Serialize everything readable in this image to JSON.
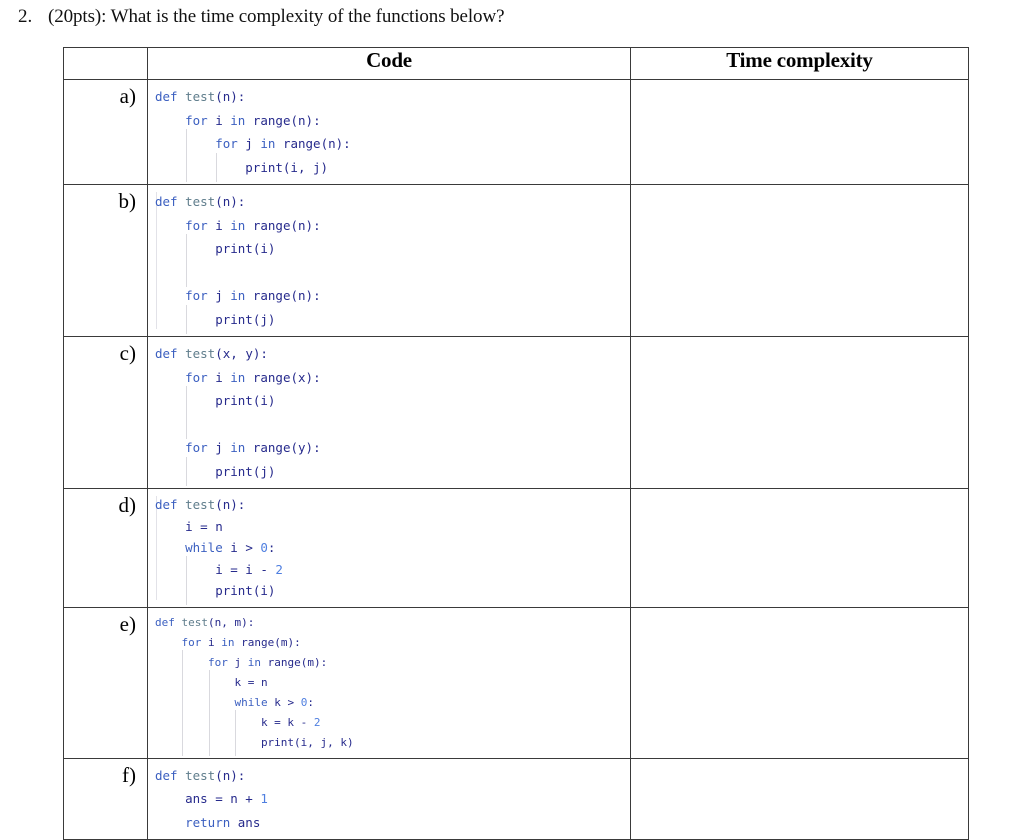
{
  "question": {
    "number": "2.",
    "text": "(20pts): What is the time complexity of the functions below?"
  },
  "table": {
    "headers": {
      "label_col": "",
      "code_col": "Code",
      "answer_col": "Time complexity"
    },
    "rows": [
      {
        "label": "a)",
        "answer": "",
        "code": "def test(n):\n    for i in range(n):\n        for j in range(n):\n            print(i, j)"
      },
      {
        "label": "b)",
        "answer": "",
        "code": "def test(n):\n    for i in range(n):\n        print(i)\n\n    for j in range(n):\n        print(j)"
      },
      {
        "label": "c)",
        "answer": "",
        "code": "def test(x, y):\n    for i in range(x):\n        print(i)\n\n    for j in range(y):\n        print(j)"
      },
      {
        "label": "d)",
        "answer": "",
        "code": "def test(n):\n    i = n\n    while i > 0:\n        i = i - 2\n        print(i)"
      },
      {
        "label": "e)",
        "answer": "",
        "code": "def test(n, m):\n    for i in range(m):\n        for j in range(m):\n            k = n\n            while k > 0:\n                k = k - 2\n                print(i, j, k)"
      },
      {
        "label": "f)",
        "answer": "",
        "code": "def test(n):\n    ans = n + 1\n    return ans"
      }
    ]
  },
  "colors": {
    "keyword": "#3b5fc0",
    "function_name": "#5f7d8c",
    "number": "#4f7fe0",
    "plain": "#262a8c",
    "border": "#3a3a3a",
    "indent_guide": "#d9d9de",
    "background": "#ffffff"
  }
}
